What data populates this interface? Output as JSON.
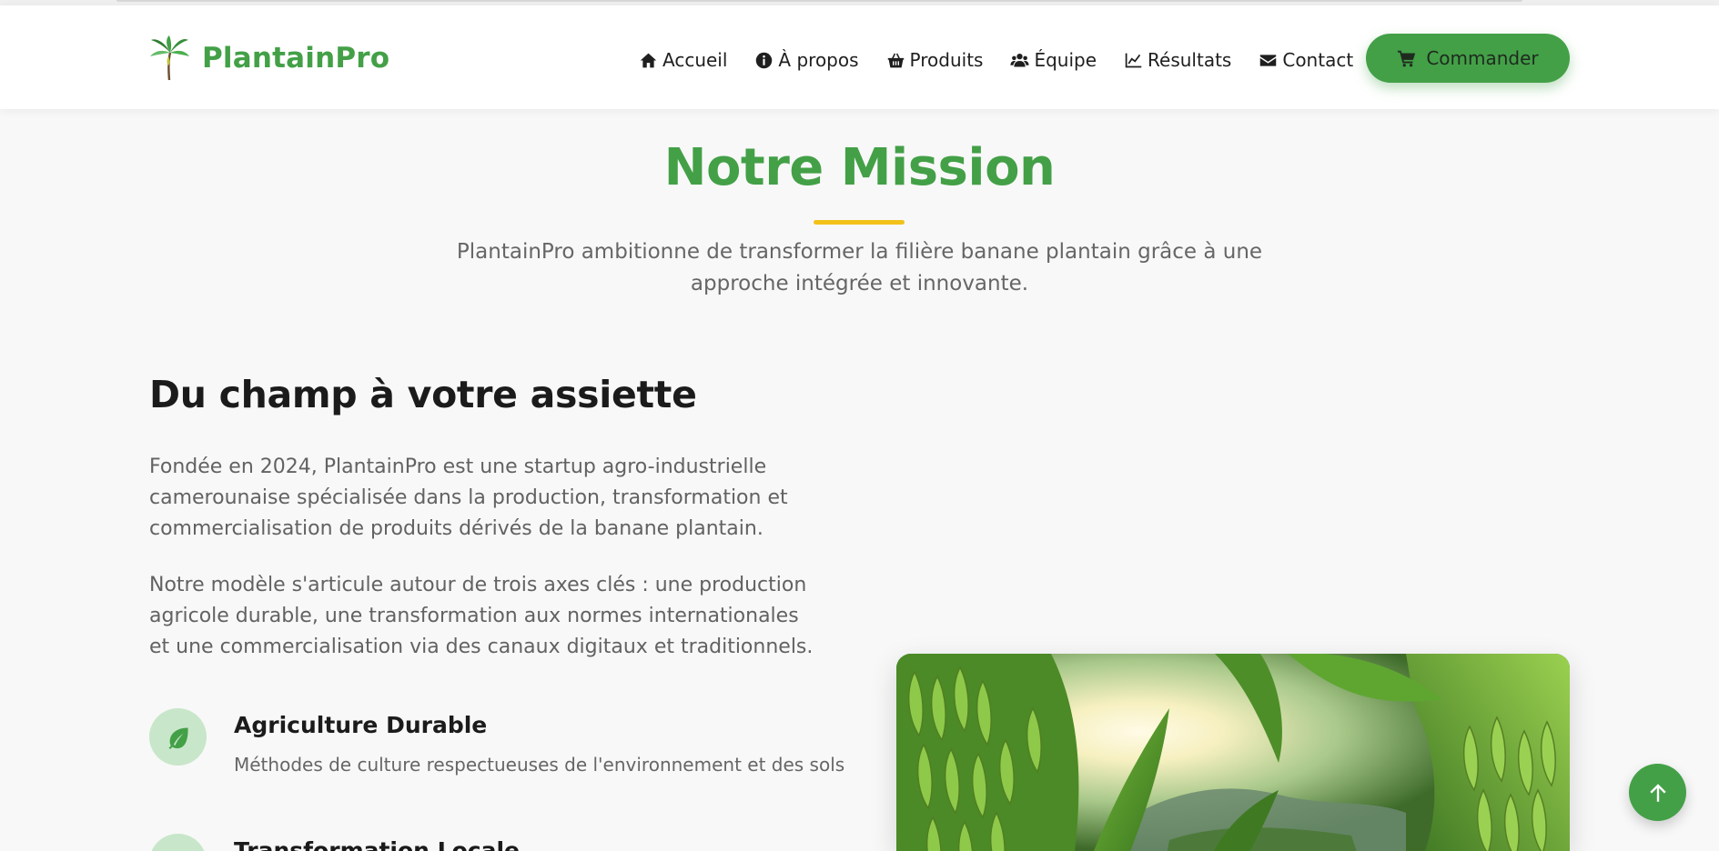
{
  "brand": {
    "name": "PlantainPro",
    "logo_icon": "banana-tree-icon",
    "accent_color": "#43a047",
    "underline_color": "#f2c21b"
  },
  "nav": {
    "items": [
      {
        "label": "Accueil",
        "icon": "home-icon"
      },
      {
        "label": "À propos",
        "icon": "info-circle-icon"
      },
      {
        "label": "Produits",
        "icon": "basket-icon"
      },
      {
        "label": "Équipe",
        "icon": "users-icon"
      },
      {
        "label": "Résultats",
        "icon": "line-chart-icon"
      },
      {
        "label": "Contact",
        "icon": "envelope-icon"
      }
    ],
    "cta": {
      "label": "Commander",
      "icon": "cart-icon"
    }
  },
  "mission": {
    "title": "Notre Mission",
    "subtitle": "PlantainPro ambitionne de transformer la filière banane plantain grâce à une approche intégrée et innovante."
  },
  "about": {
    "title": "Du champ à votre assiette",
    "paragraph1": "Fondée en 2024, PlantainPro est une startup agro-industrielle camerounaise spécialisée dans la production, transformation et commercialisation de produits dérivés de la banane plantain.",
    "paragraph2": "Notre modèle s'articule autour de trois axes clés : une production agricole durable, une transformation aux normes internationales et une commercialisation via des canaux digitaux et traditionnels.",
    "features": [
      {
        "title": "Agriculture Durable",
        "description": "Méthodes de culture respectueuses de l'environnement et des sols",
        "icon": "leaf-icon"
      },
      {
        "title": "Transformation Locale",
        "description": "",
        "icon": "leaf-icon"
      }
    ]
  },
  "image": {
    "subject": "plantain-plantation-photo"
  },
  "scroll_top": {
    "icon": "arrow-up-icon"
  }
}
